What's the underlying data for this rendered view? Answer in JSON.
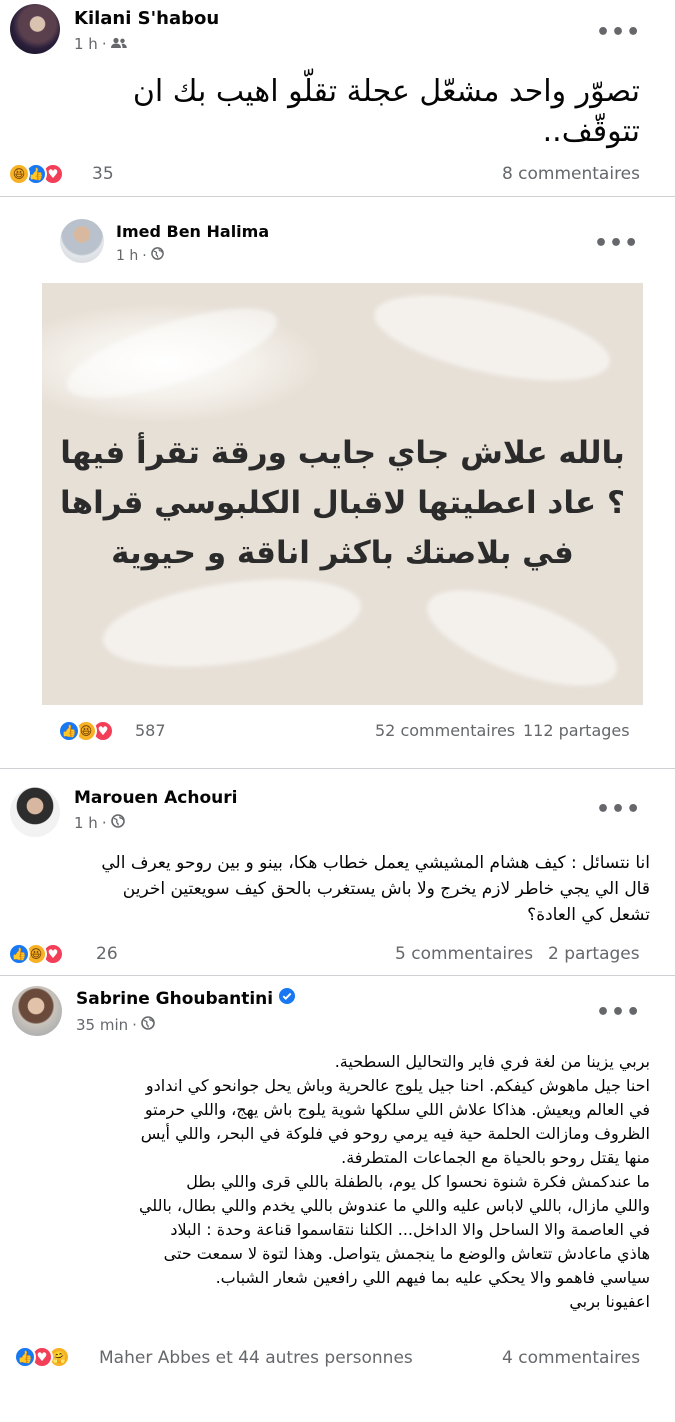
{
  "post1": {
    "author": "Kilani S'habou",
    "time": "1 h",
    "audience_icon": "friends-icon",
    "text": "تصوّر واحد مشعّل عجلة تقلّو اهيب بك ان تتوقّف..",
    "reactions": [
      "haha",
      "like",
      "love"
    ],
    "reaction_count": "35",
    "comments": "8 commentaires"
  },
  "post2": {
    "author": "Imed Ben Halima",
    "time": "1 h",
    "audience_icon": "globe-icon",
    "image_text_lines": [
      "بالله علاش جاي جايب ورقة تقرأ فيها",
      "؟ عاد اعطيتها لاقبال الكلبوسي قراها",
      "في بلاصتك باكثر اناقة و حيوية"
    ],
    "reactions": [
      "like",
      "haha",
      "love"
    ],
    "reaction_count": "587",
    "comments": "52 commentaires",
    "shares": "112 partages"
  },
  "post3": {
    "author": "Marouen Achouri",
    "time": "1 h",
    "audience_icon": "globe-icon",
    "text_lines": [
      "انا نتسائل : كيف هشام المشيشي يعمل خطاب هكا، بينو و بين روحو يعرف الي",
      "قال الي يجي خاطر لازم يخرج ولا باش يستغرب بالحق كيف سويعتين اخرين",
      "تشعل كي العادة؟"
    ],
    "reactions": [
      "like",
      "haha",
      "love"
    ],
    "reaction_count": "26",
    "comments": "5 commentaires",
    "shares": "2 partages"
  },
  "post4": {
    "author": "Sabrine Ghoubantini",
    "verified_icon": "verified-badge-icon",
    "time": "35 min",
    "audience_icon": "globe-icon",
    "text_lines": [
      "بربي يزينا من لغة فري فاير والتحاليل السطحية.",
      "احنا جيل ماهوش كيفكم. احنا جيل يلوج عالحرية وباش يحل جوانحو كي اندادو",
      "في العالم ويعيش. هذاكا علاش اللي سلكها شوية يلوج باش يهج، واللي حرمتو",
      "الظروف ومازالت الحلمة حية فيه يرمي روحو في فلوكة في البحر، واللي أيس",
      "منها يقتل روحو بالحياة مع الجماعات المتطرفة.",
      "ما عندكمش فكرة شنوة نحسوا كل يوم، بالطفلة باللي قرى واللي بطل",
      "واللي مازال، باللي لاباس عليه واللي ما عندوش باللي يخدم واللي بطال، باللي",
      "في العاصمة والا الساحل والا الداخل... الكلنا نتقاسموا قناعة وحدة : البلاد",
      "هاذي ماعادش تتعاش والوضع ما ينجمش يتواصل. وهذا لتوة لا سمعت حتى",
      "سياسي فاهمو والا يحكي عليه بما فيهم اللي رافعين شعار الشباب.",
      "اعفيونا بربي"
    ],
    "reactions": [
      "like",
      "love",
      "care"
    ],
    "reactors": "Maher Abbes et 44 autres personnes",
    "comments": "4 commentaires"
  }
}
